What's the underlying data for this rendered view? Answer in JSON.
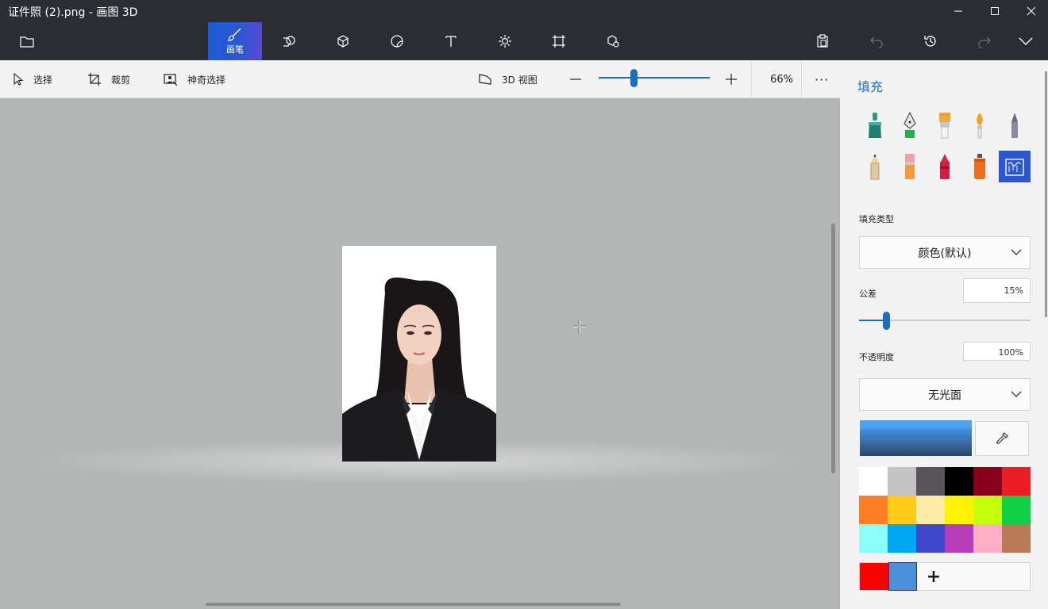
{
  "window": {
    "title": "证件照 (2).png - 画图 3D",
    "controls": [
      "minimize-icon",
      "maximize-icon",
      "close-icon"
    ]
  },
  "toolbar": {
    "active_tool_label": "画笔",
    "tools": [
      "brush-icon",
      "2d-shapes-icon",
      "3d-shapes-icon",
      "stickers-icon",
      "text-icon",
      "effects-icon",
      "canvas-icon",
      "3d-library-icon"
    ],
    "right_tools": [
      "paste-icon",
      "undo-icon",
      "history-icon",
      "redo-icon",
      "expand-chevron-icon"
    ]
  },
  "subtoolbar": {
    "select_label": "选择",
    "crop_label": "裁剪",
    "magic_select_label": "神奇选择",
    "view3d_label": "3D 视图",
    "zoom_value": "66%",
    "zoom_level": 0.32,
    "more_label": "···"
  },
  "panel": {
    "title": "填充",
    "brushes": [
      "marker",
      "calligraphy-pen",
      "oil-brush",
      "watercolor",
      "pixel-pen",
      "pencil",
      "eraser",
      "crayon",
      "spraycan",
      "fill"
    ],
    "selected_brush": "fill",
    "fill_type_label": "填充类型",
    "fill_type_value": "颜色(默认)",
    "tolerance_label": "公差",
    "tolerance_value": "15%",
    "tolerance_level": 0.15,
    "opacity_label": "不透明度",
    "opacity_value": "100%",
    "material_value": "无光面",
    "current_color": "#4a90d9",
    "palette": [
      "#ffffff",
      "#c3c3c3",
      "#585458",
      "#000000",
      "#88001b",
      "#ec1c24",
      "#ff7f27",
      "#ffca18",
      "#fdeca6",
      "#fff200",
      "#c4ff0e",
      "#0ed145",
      "#8cfffb",
      "#00a8f3",
      "#3f48cc",
      "#b83dba",
      "#ffaec8",
      "#b97a56"
    ],
    "recent_colors": [
      "#ff0000",
      "#4a90d9"
    ],
    "add_color_label": "+"
  }
}
